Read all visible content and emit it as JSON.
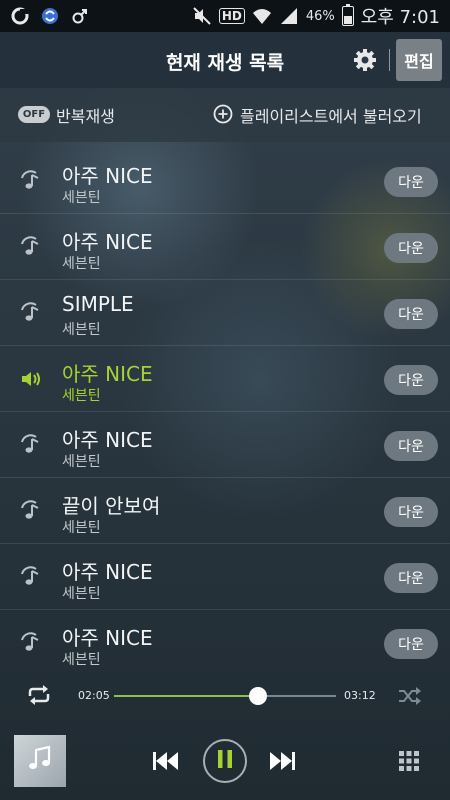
{
  "status_bar": {
    "battery": "46%",
    "time": "오후 7:01",
    "hd_label": "HD",
    "icons": [
      "carrier-o-icon",
      "sync-icon",
      "gender-icon",
      "mute-icon",
      "hd-icon",
      "wifi-icon",
      "signal-icon",
      "battery-icon"
    ]
  },
  "header": {
    "title": "현재 재생 목록",
    "edit_label": "편집"
  },
  "options": {
    "repeat_toggle": "OFF",
    "repeat_label": "반복재생",
    "add_from_playlist": "플레이리스트에서 불러오기"
  },
  "songs": [
    {
      "title": "아주 NICE",
      "artist": "세븐틴",
      "down": "다운",
      "active": false
    },
    {
      "title": "아주 NICE",
      "artist": "세븐틴",
      "down": "다운",
      "active": false
    },
    {
      "title": "SIMPLE",
      "artist": "세븐틴",
      "down": "다운",
      "active": false
    },
    {
      "title": "아주 NICE",
      "artist": "세븐틴",
      "down": "다운",
      "active": true
    },
    {
      "title": "아주 NICE",
      "artist": "세븐틴",
      "down": "다운",
      "active": false
    },
    {
      "title": "끝이 안보여",
      "artist": "세븐틴",
      "down": "다운",
      "active": false
    },
    {
      "title": "아주 NICE",
      "artist": "세븐틴",
      "down": "다운",
      "active": false
    },
    {
      "title": "아주 NICE",
      "artist": "세븐틴",
      "down": "다운",
      "active": false
    }
  ],
  "player": {
    "current_time": "02:05",
    "total_time": "03:12",
    "progress_fraction": 0.65
  },
  "colors": {
    "accent": "#a6d233",
    "progress": "#8bc34a"
  }
}
